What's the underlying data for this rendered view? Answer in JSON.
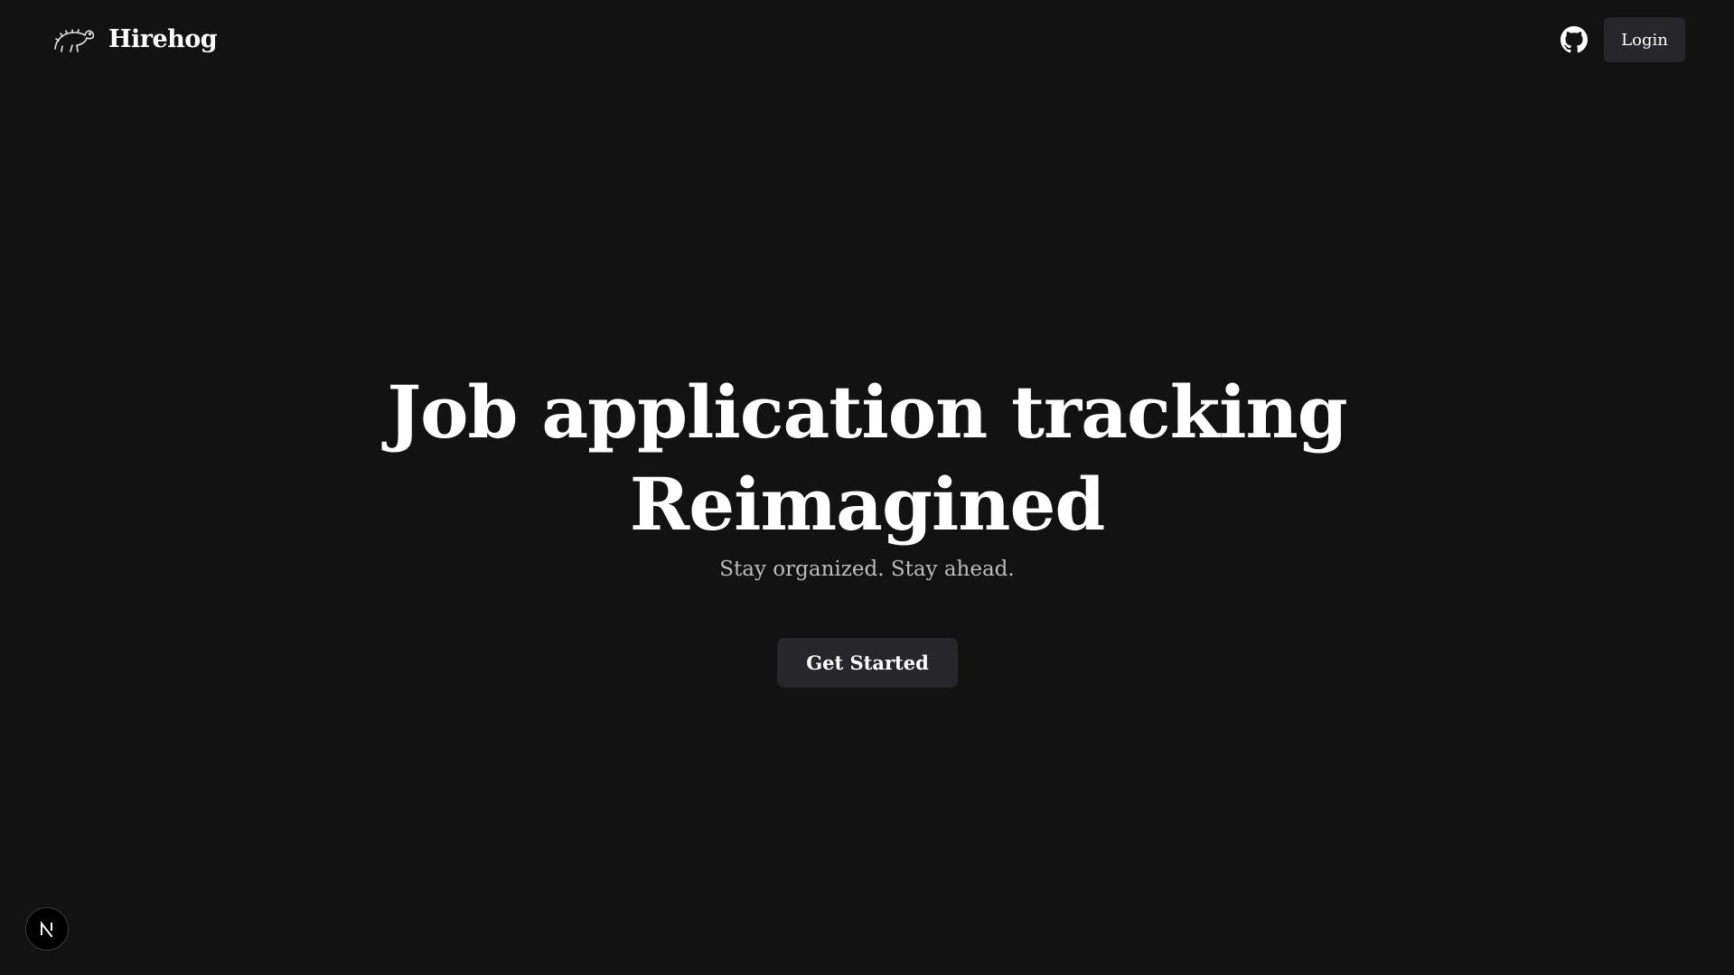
{
  "header": {
    "brand_name": "Hirehog",
    "login_label": "Login",
    "github_icon": "github-icon",
    "logo_icon": "hedgehog-logo-icon"
  },
  "hero": {
    "title_line1": "Job application tracking",
    "title_line2": "Reimagined",
    "subtitle": "Stay organized. Stay ahead.",
    "cta_label": "Get Started"
  },
  "dev_badge": {
    "icon": "nextjs-icon"
  },
  "colors": {
    "background": "#121212",
    "button_bg": "#26262b",
    "text": "#ffffff",
    "subtitle": "#bdbdbd"
  }
}
